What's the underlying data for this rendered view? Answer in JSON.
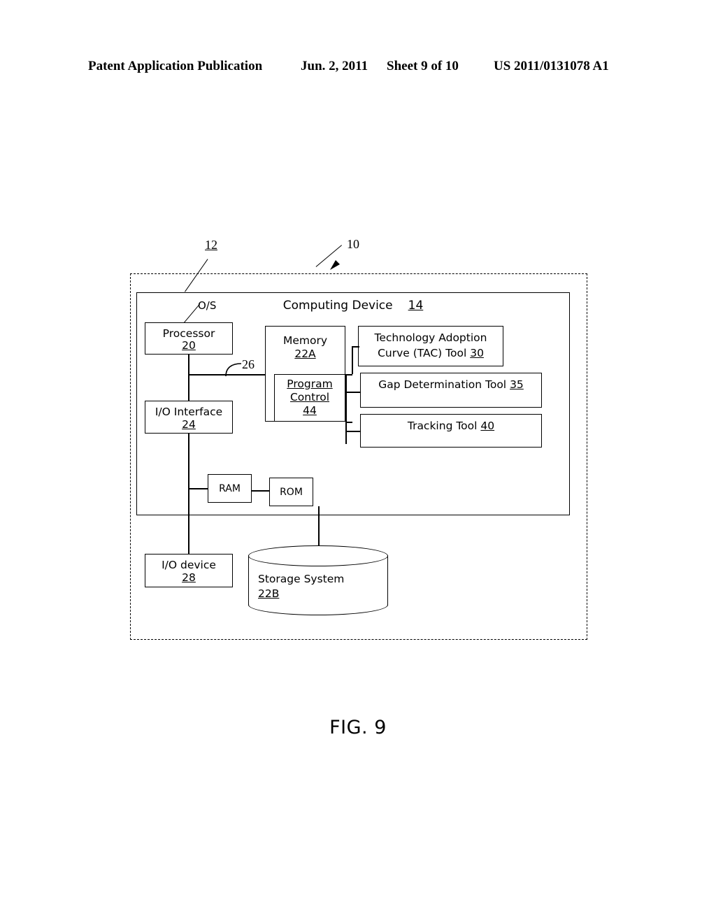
{
  "header": {
    "publication": "Patent Application Publication",
    "date": "Jun. 2, 2011",
    "sheet": "Sheet 9 of 10",
    "number": "US 2011/0131078 A1"
  },
  "figure": {
    "caption": "FIG. 9",
    "environment_ref": "12",
    "system_ref": "10",
    "os_label": "O/S",
    "bus_ref": "26"
  },
  "computing_device": {
    "title": "Computing Device",
    "ref": "14"
  },
  "blocks": {
    "processor": {
      "label": "Processor",
      "ref": "20"
    },
    "io_interface": {
      "label": "I/O Interface",
      "ref": "24"
    },
    "memory": {
      "label": "Memory",
      "ref": "22A"
    },
    "program_control": {
      "line1": "Program",
      "line2": "Control",
      "ref": "44"
    },
    "ram": {
      "label": "RAM"
    },
    "rom": {
      "label": "ROM"
    },
    "io_device": {
      "label": "I/O device",
      "ref": "28"
    },
    "storage_system": {
      "label": "Storage System",
      "ref": "22B"
    }
  },
  "tools": {
    "tac": {
      "line1": "Technology Adoption",
      "line2": "Curve (TAC) Tool",
      "ref": "30"
    },
    "gap": {
      "label": "Gap Determination Tool",
      "ref": "35"
    },
    "tracking": {
      "label": "Tracking Tool",
      "ref": "40"
    }
  }
}
